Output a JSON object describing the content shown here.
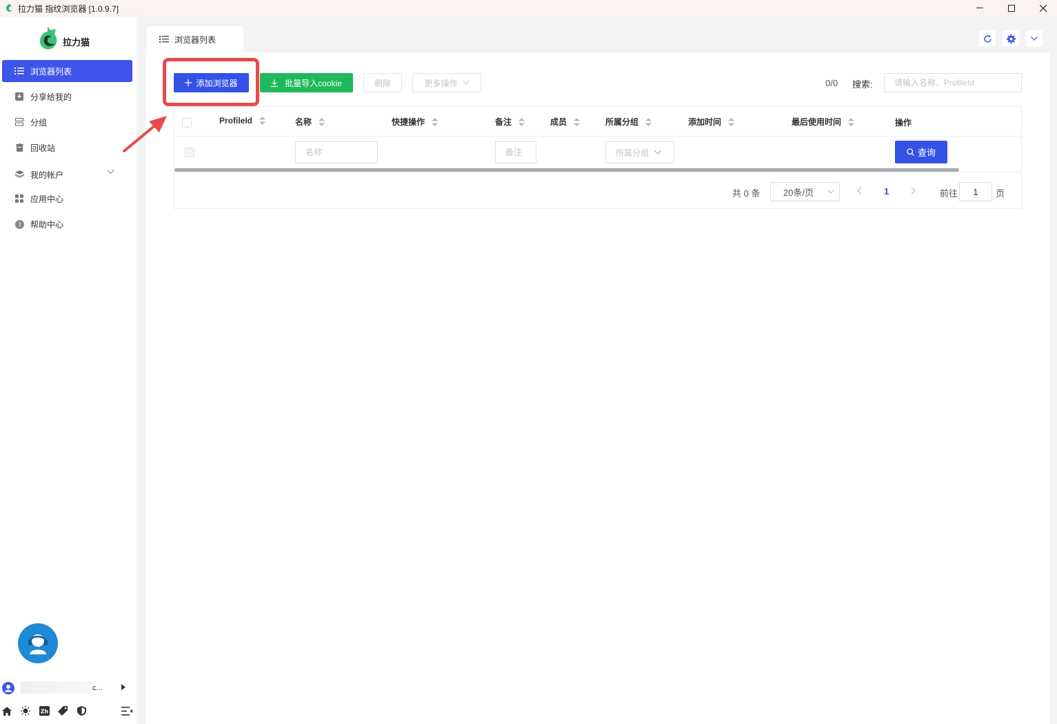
{
  "window": {
    "title": "拉力猫 指纹浏览器  [1.0.9.7]"
  },
  "sidebar": {
    "logo_text": "拉力猫",
    "items": [
      {
        "label": "浏览器列表",
        "icon": "list-icon",
        "active": true
      },
      {
        "label": "分享给我的",
        "icon": "download-icon",
        "active": false
      },
      {
        "label": "分组",
        "icon": "group-icon",
        "active": false
      },
      {
        "label": "回收站",
        "icon": "trash-icon",
        "active": false
      },
      {
        "label": "我的帐户",
        "icon": "account-icon",
        "active": false,
        "expandable": true
      },
      {
        "label": "应用中心",
        "icon": "apps-icon",
        "active": false
      },
      {
        "label": "帮助中心",
        "icon": "help-icon",
        "active": false
      }
    ],
    "user_name": "c..."
  },
  "tabs": [
    {
      "label": "浏览器列表",
      "icon": "list-icon"
    }
  ],
  "toolbar": {
    "add_browser": "添加浏览器",
    "import_cookie": "批量导入cookie",
    "delete": "删除",
    "more_actions": "更多操作",
    "count": "0/0",
    "search_label": "搜索:",
    "search_placeholder": "请输入名称、ProfileId"
  },
  "table": {
    "columns": [
      "ProfileId",
      "名称",
      "快捷操作",
      "备注",
      "成员",
      "所属分组",
      "添加时间",
      "最后使用时间",
      "操作"
    ],
    "filters": {
      "name_placeholder": "名称",
      "remark_placeholder": "备注",
      "group_placeholder": "所属分组",
      "query_button": "查询"
    },
    "rows": []
  },
  "pagination": {
    "total": "共 0 条",
    "page_size": "20条/页",
    "current_page": "1",
    "goto_label": "前往",
    "goto_value": "1",
    "page_suffix": "页"
  },
  "colors": {
    "primary": "#3452e6",
    "success": "#1fb85a",
    "highlight": "#e94b4b",
    "sidebar_active": "#3d55e8"
  }
}
